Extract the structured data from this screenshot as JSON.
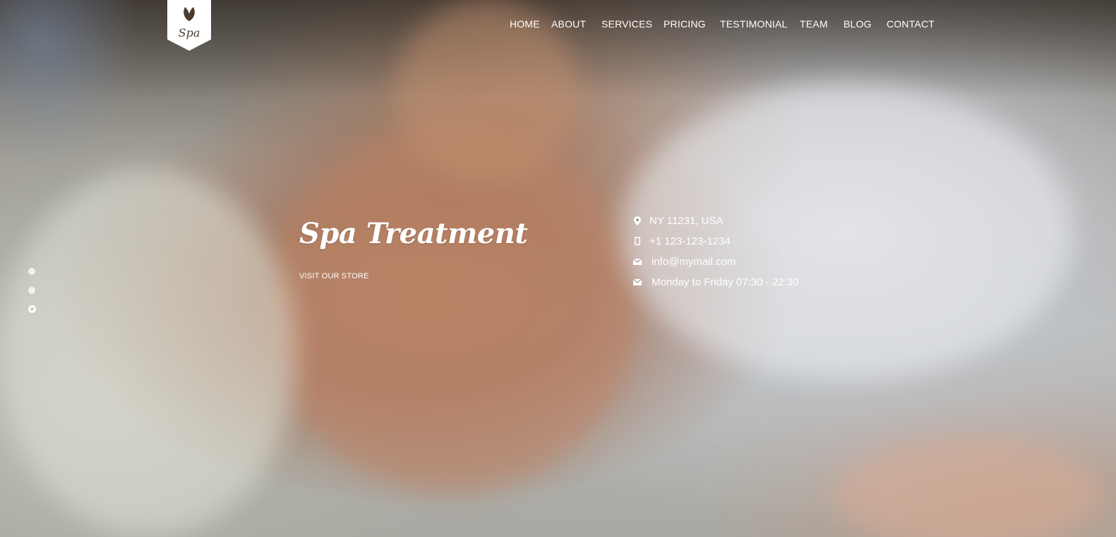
{
  "logo": {
    "text": "Spa",
    "icon": "leaf-icon"
  },
  "nav": {
    "items": [
      {
        "label": "HOME"
      },
      {
        "label": "ABOUT"
      },
      {
        "label": "SERVICES"
      },
      {
        "label": "PRICING"
      },
      {
        "label": "TESTIMONIAL"
      },
      {
        "label": "TEAM"
      },
      {
        "label": "BLOG"
      },
      {
        "label": "CONTACT"
      }
    ]
  },
  "hero": {
    "title": "Spa Treatment",
    "cta": "VISIT OUR STORE"
  },
  "contact": {
    "address": "NY 11231, USA",
    "phone": "+1 123-123-1234",
    "email": "info@mymail.com",
    "hours": "Monday to Friday 07:30 - 22:30",
    "icons": [
      "map-pin-icon",
      "phone-icon",
      "envelope-icon",
      "envelope-icon"
    ]
  },
  "slider": {
    "slide_count": 3,
    "active_slide": 3
  },
  "colors": {
    "text": "#ffffff",
    "logo_bg": "#ffffff",
    "logo_fg": "#4a3b30"
  }
}
